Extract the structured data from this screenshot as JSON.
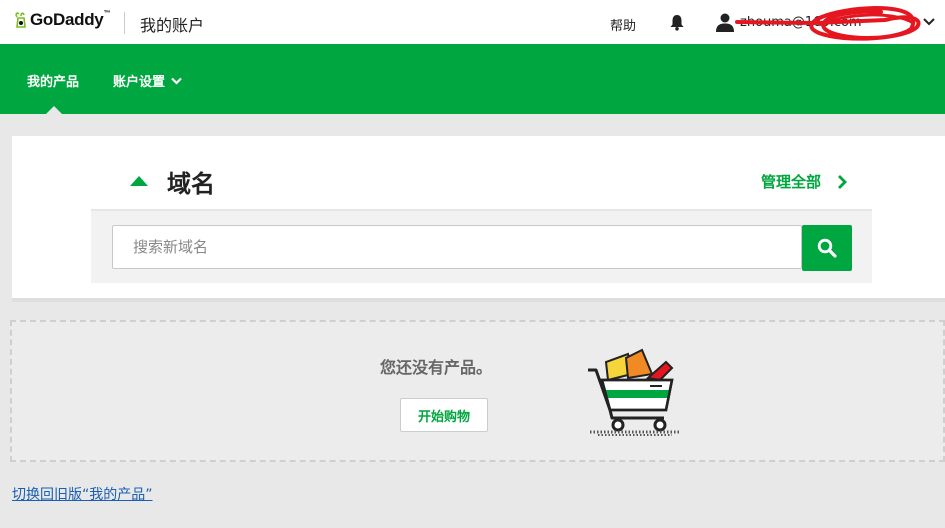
{
  "header": {
    "logo_text": "GoDaddy",
    "logo_tm": "™",
    "account_title": "我的账户",
    "help_label": "帮助",
    "user_email": "zhouma@163.com",
    "icons": [
      "bell-icon",
      "user-icon",
      "chevron-down-icon"
    ]
  },
  "nav": {
    "products_label": "我的产品",
    "settings_label": "账户设置"
  },
  "domain": {
    "title": "域名",
    "manage_all_label": "管理全部",
    "search_placeholder": "搜索新域名",
    "search_value": ""
  },
  "products": {
    "empty_text": "您还没有产品。",
    "start_button_label": "开始购物"
  },
  "footer": {
    "switch_link": "切换回旧版“我的产品”"
  },
  "colors": {
    "brand_green": "#00a63f",
    "link_blue": "#1a5fb4",
    "background": "#e8e8e8"
  }
}
